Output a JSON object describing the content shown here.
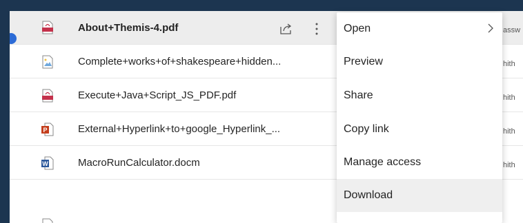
{
  "files": [
    {
      "name": "About+Themis-4.pdf",
      "type": "pdf",
      "selected": true,
      "side": "assw"
    },
    {
      "name": "Complete+works+of+shakespeare+hidden...",
      "type": "image",
      "selected": false,
      "side": "hith"
    },
    {
      "name": "Execute+Java+Script_JS_PDF.pdf",
      "type": "pdf",
      "selected": false,
      "side": "hith"
    },
    {
      "name": "External+Hyperlink+to+google_Hyperlink_...",
      "type": "ppt",
      "selected": false,
      "side": "hith"
    },
    {
      "name": "MacroRunCalculator.docm",
      "type": "word",
      "selected": false,
      "side": "hith"
    }
  ],
  "row_actions": {
    "share_icon": "share-icon",
    "more_icon": "more-vertical-icon"
  },
  "context_menu": {
    "items": [
      {
        "label": "Open",
        "has_submenu": true
      },
      {
        "label": "Preview"
      },
      {
        "label": "Share"
      },
      {
        "label": "Copy link"
      },
      {
        "label": "Manage access"
      },
      {
        "label": "Download",
        "hovered": true
      }
    ]
  },
  "colors": {
    "background": "#1c3550",
    "pdf_red": "#c4314b",
    "ppt_red": "#c43e1c",
    "word_blue": "#2b579a",
    "selected_check": "#2c6bd6"
  }
}
